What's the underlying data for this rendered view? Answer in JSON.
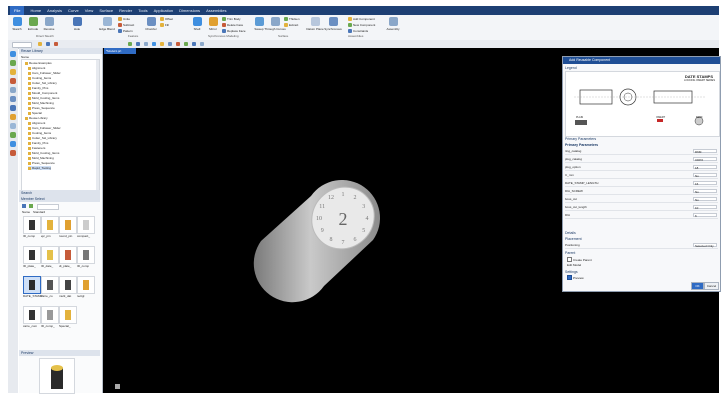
{
  "menu": {
    "file": "File",
    "items": [
      "Home",
      "Analysis",
      "Curve",
      "View",
      "Surface",
      "Render",
      "Tools",
      "Application",
      "Dimensions",
      "Assemblies"
    ]
  },
  "ribbon": {
    "buttons": [
      "Sketch",
      "Extrude",
      "Revolve",
      "Hole",
      "Edge Blend",
      "Chamfer",
      "Shell",
      "Mirror",
      "Sweep",
      "Through Curves",
      "Datum Plane",
      "Synchronous",
      "Assembly"
    ],
    "small": [
      "Unite",
      "Subtract",
      "Pattern",
      "Offset",
      "Fill",
      "Trim Body",
      "Delete Face",
      "Replace Face",
      "Thicken",
      "Extract",
      "Add Component",
      "New Component",
      "Constraints"
    ],
    "groups": [
      "Direct Sketch",
      "Feature",
      "Synchronous Modeling",
      "Surface",
      "Assemblies"
    ]
  },
  "viewport_tab": "*Model1.prt",
  "navigator": {
    "title": "Reuse Library",
    "tree_label": "Name",
    "top_rows": [
      "Reuse Examples",
      "Alignment",
      "Cam_Follower_Slider",
      "Cooling_Items",
      "Cutter_Ssl_Library",
      "Family_Pins",
      "Mould_Component",
      "Mold_Cooling_Items",
      "Mold_Machining",
      "Press_Sequence",
      "Special"
    ],
    "second_rows": [
      "Reuse Library",
      "Alignment",
      "Cam_Follower_Slider",
      "Cooling_Items",
      "Cutter_Ssl_Library",
      "Family_Pins",
      "Fasteners",
      "Mold_Cooling_Items",
      "Mold_Machining",
      "Press_Sequence",
      "Rapid_Tooling"
    ],
    "search_label": "Search",
    "member_select": "Member Select",
    "name_label": "Name",
    "standard_label": "Standard",
    "parts": [
      "ID_comp",
      "ejc_pin",
      "round_pin",
      "compact_",
      "ID_plate_",
      "ID_date_",
      "dt_plate_",
      "ID_comp",
      "DATE_STAMP",
      "carre_co",
      "multi_dat",
      "rectgl",
      "carre_com",
      "ID_comp_",
      "Special_"
    ],
    "preview_title": "Preview"
  },
  "dialog": {
    "title": "Add Reusable Component",
    "legend_label": "Legend",
    "drawing_title": "DATE STAMPS",
    "drawing_subtitle": "LOCKING INSERT SERIES",
    "labels": [
      "PLAIN",
      "INSERT",
      "KERF"
    ],
    "section_params": "Primary Parameters",
    "primary_parameters": "Primary Parameters",
    "params": [
      {
        "name": "ring_catalog",
        "value": "D6M"
      },
      {
        "name": "plug_catalog",
        "value": "CDP2"
      },
      {
        "name": "plug_option",
        "value": "18"
      },
      {
        "name": "C_mm",
        "value": "No"
      },
      {
        "name": "DATE_STAMP_LENGTH",
        "value": "16"
      },
      {
        "name": "DIA_SCREW",
        "value": "No"
      },
      {
        "name": "boss_cut",
        "value": "No"
      },
      {
        "name": "boss_cut_length",
        "value": "10"
      },
      {
        "name": "DIA",
        "value": "6"
      }
    ],
    "details": "Details",
    "placement": "Placement",
    "positioning": "Positioning",
    "positioning_value": "Selected Only",
    "parent": "Parent",
    "create_parent": "Create Parent",
    "edit_model": "Edit Model",
    "settings": "Settings",
    "preview": "Preview",
    "ok": "OK",
    "cancel": "Cancel"
  },
  "model": {
    "stamp_text": "2",
    "stamp_marks": [
      "1",
      "2",
      "3",
      "4",
      "5",
      "6",
      "7",
      "8",
      "9",
      "10",
      "11",
      "12"
    ]
  }
}
